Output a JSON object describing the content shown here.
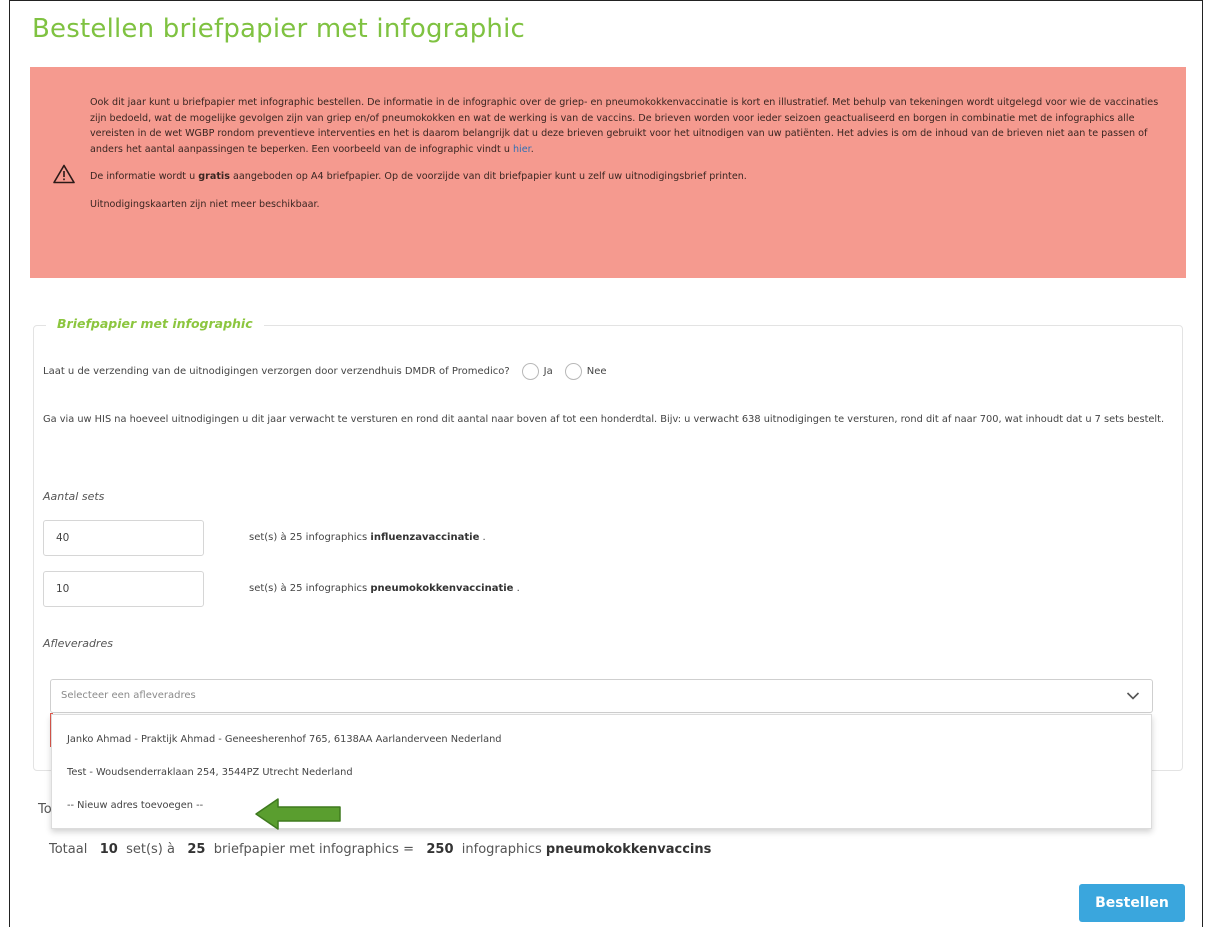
{
  "page": {
    "title": "Bestellen briefpapier met infographic"
  },
  "alert": {
    "icon": "warning-icon",
    "paragraph1": "Ook dit jaar kunt u briefpapier met infographic bestellen. De informatie in de infographic over de griep- en pneumokokkenvaccinatie is kort en illustratief. Met behulp van tekeningen wordt uitgelegd voor wie de vaccinaties zijn bedoeld, wat de mogelijke gevolgen zijn van griep en/of pneumokokken en wat de werking is van de vaccins. De brieven worden voor ieder seizoen geactualiseerd en borgen in combinatie met de infographics alle vereisten in de wet WGBP rondom preventieve interventies en het is daarom belangrijk dat u deze brieven gebruikt voor het uitnodigen van uw patiënten. Het advies is om de inhoud van de brieven niet aan te passen of anders het aantal aanpassingen te beperken. Een voorbeeld van de infographic vindt u",
    "link_text": "hier",
    "link_suffix": ".",
    "paragraph2_prefix": "De informatie wordt u",
    "paragraph2_bold": "gratis",
    "paragraph2_suffix": "aangeboden op A4 briefpapier. Op de voorzijde van dit briefpapier kunt u zelf uw uitnodigingsbrief printen.",
    "paragraph3": "Uitnodigingskaarten zijn niet meer beschikbaar."
  },
  "form": {
    "legend": "Briefpapier met infographic",
    "shipping_question": "Laat u de verzending van de uitnodigingen verzorgen door verzendhuis DMDR of Promedico?",
    "radio_yes": "Ja",
    "radio_no": "Nee",
    "hint": "Ga via uw HIS na hoeveel uitnodigingen u dit jaar verwacht te versturen en rond dit aantal naar boven af tot een honderdtal. Bijv: u verwacht 638 uitnodigingen te versturen, rond dit af naar 700, wat inhoudt dat u 7 sets bestelt.",
    "sets_label": "Aantal sets",
    "influenza": {
      "value": "40",
      "text_prefix": "set(s) à 25 infographics",
      "text_bold": "influenzavaccinatie",
      "text_suffix": "."
    },
    "pneumo": {
      "value": "10",
      "text_prefix": "set(s) à 25 infographics",
      "text_bold": "pneumokokkenvaccinatie",
      "text_suffix": "."
    },
    "address_label": "Afleveradres",
    "address_placeholder": "Selecteer een afleveradres",
    "address_options": [
      "Janko Ahmad - Praktijk Ahmad - Geneesherenhof 765, 6138AA Aarlanderveen Nederland",
      "Test - Woudsenderraklaan 254, 3544PZ Utrecht Nederland",
      "-- Nieuw adres toevoegen --"
    ]
  },
  "totals": {
    "partial": "To",
    "word": "Totaal",
    "sets": "10",
    "mid1": "set(s) à",
    "per_set": "25",
    "mid2": "briefpapier met infographics =",
    "count": "250",
    "mid3": "infographics",
    "product": "pneumokokkenvaccins"
  },
  "actions": {
    "order_button": "Bestellen"
  },
  "colors": {
    "title_green": "#7fc241",
    "alert_bg": "#f59a8f",
    "button_blue": "#3aa6dd",
    "arrow_green": "#5a9e2f"
  }
}
